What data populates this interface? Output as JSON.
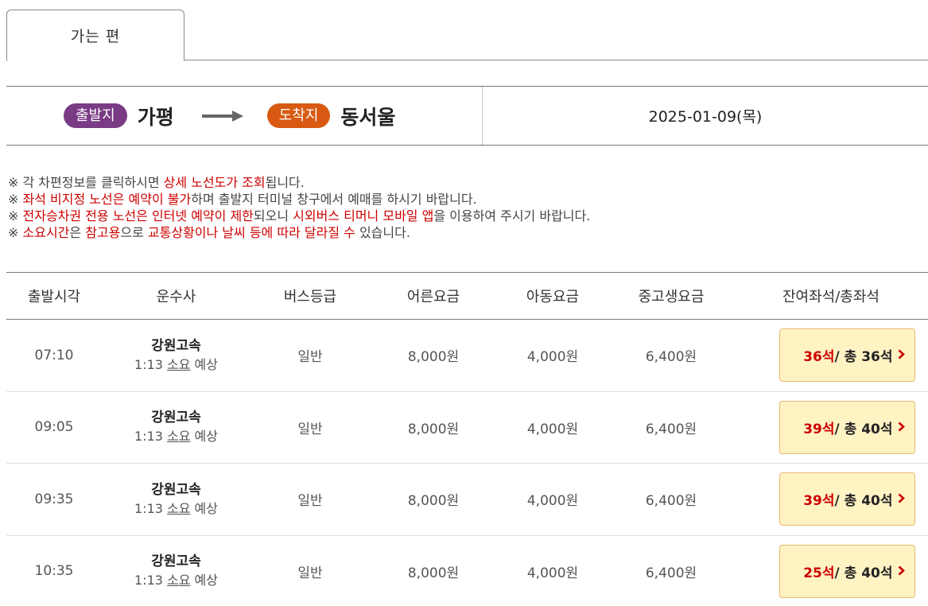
{
  "tabs": [
    {
      "label": "가는 편"
    }
  ],
  "route": {
    "departure_badge": "출발지",
    "departure": "가평",
    "arrival_badge": "도착지",
    "arrival": "동서울",
    "date": "2025-01-09(목)"
  },
  "notices": [
    [
      {
        "t": "※ 각 차편정보를 클릭하시면 "
      },
      {
        "t": "상세 노선도가 조회",
        "red": true
      },
      {
        "t": "됩니다."
      }
    ],
    [
      {
        "t": "※ "
      },
      {
        "t": "좌석 비지정 노선은 예약이 불가",
        "red": true
      },
      {
        "t": "하며 출발지 터미널 창구에서 예매를 하시기 바랍니다."
      }
    ],
    [
      {
        "t": "※ "
      },
      {
        "t": "전자승차권 전용 노선은 인터넷 예약이 제한",
        "red": true
      },
      {
        "t": "되오니 "
      },
      {
        "t": "시외버스 티머니 모바일 앱",
        "red": true
      },
      {
        "t": "을 이용하여 주시기 바랍니다."
      }
    ],
    [
      {
        "t": "※ "
      },
      {
        "t": "소요시간",
        "red": true
      },
      {
        "t": "은 "
      },
      {
        "t": "참고용",
        "red": true
      },
      {
        "t": "으로 "
      },
      {
        "t": "교통상황이나 날씨 등에 따라 달라질 수",
        "red": true
      },
      {
        "t": " 있습니다."
      }
    ]
  ],
  "table": {
    "headers": [
      "출발시각",
      "운수사",
      "버스등급",
      "어른요금",
      "아동요금",
      "중고생요금",
      "잔여좌석/총좌석"
    ],
    "rows": [
      {
        "time": "07:10",
        "company": "강원고속",
        "duration_pre": "1:13 ",
        "duration_u": "소요",
        "duration_post": " 예상",
        "grade": "일반",
        "adult": "8,000원",
        "child": "4,000원",
        "youth": "6,400원",
        "remain": "36석",
        "total": " / 총 36석"
      },
      {
        "time": "09:05",
        "company": "강원고속",
        "duration_pre": "1:13 ",
        "duration_u": "소요",
        "duration_post": " 예상",
        "grade": "일반",
        "adult": "8,000원",
        "child": "4,000원",
        "youth": "6,400원",
        "remain": "39석",
        "total": " / 총 40석"
      },
      {
        "time": "09:35",
        "company": "강원고속",
        "duration_pre": "1:13 ",
        "duration_u": "소요",
        "duration_post": " 예상",
        "grade": "일반",
        "adult": "8,000원",
        "child": "4,000원",
        "youth": "6,400원",
        "remain": "39석",
        "total": " / 총 40석"
      },
      {
        "time": "10:35",
        "company": "강원고속",
        "duration_pre": "1:13 ",
        "duration_u": "소요",
        "duration_post": " 예상",
        "grade": "일반",
        "adult": "8,000원",
        "child": "4,000원",
        "youth": "6,400원",
        "remain": "25석",
        "total": " / 총 40석"
      }
    ]
  },
  "colors": {
    "departure_badge": "#7a3b85",
    "arrival_badge": "#d85a12",
    "highlight": "#cc0000",
    "seat_button_bg": "#fff3c4"
  },
  "icons": {
    "route_arrow": "right-arrow-icon",
    "seat_chevron": "chevron-right-icon"
  }
}
